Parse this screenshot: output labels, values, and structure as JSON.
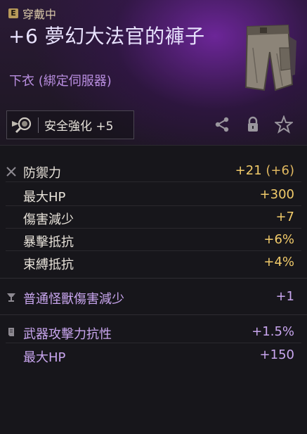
{
  "header": {
    "badge": "E",
    "equip_status": "穿戴中",
    "title": "+6 夢幻大法官的褲子",
    "subtitle": "下衣 (綁定伺服器)",
    "item_image": "pants-item-icon"
  },
  "enhance": {
    "label": "安全強化 +5",
    "icon": "magnify-enhance-icon"
  },
  "actions": {
    "share_icon": "share-icon",
    "lock_icon": "lock-icon",
    "favorite_icon": "star-icon"
  },
  "base_stats": {
    "icon": "crossed-swords-icon",
    "rows": [
      {
        "name": "防禦力",
        "value": "+21",
        "bonus": "(+6)"
      },
      {
        "name": "最大HP",
        "value": "+300",
        "bonus": ""
      },
      {
        "name": "傷害減少",
        "value": "+7",
        "bonus": ""
      },
      {
        "name": "暴擊抵抗",
        "value": "+6%",
        "bonus": ""
      },
      {
        "name": "束縛抵抗",
        "value": "+4%",
        "bonus": ""
      }
    ]
  },
  "bonus_stats": {
    "icon": "goblet-icon",
    "rows": [
      {
        "name": "普通怪獸傷害減少",
        "value": "+1"
      }
    ]
  },
  "extra_stats": {
    "icon": "scroll-icon",
    "rows": [
      {
        "name": "武器攻擊力抗性",
        "value": "+1.5%"
      },
      {
        "name": "最大HP",
        "value": "+150"
      }
    ]
  },
  "colors": {
    "gold_value": "#f2cb6a",
    "purple_text": "#c9a6ef",
    "header_glow": "#7828aa"
  }
}
